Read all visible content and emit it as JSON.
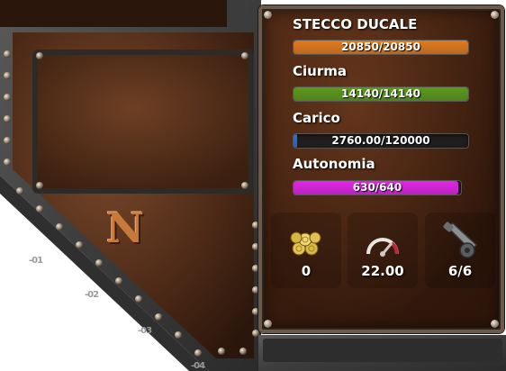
{
  "ship": {
    "name": "STECCO DUCALE"
  },
  "stats": [
    {
      "key": "hull",
      "label": "",
      "value_text": "20850/20850",
      "fill": 1.0,
      "color": "#e07b1f"
    },
    {
      "key": "crew",
      "label": "Ciurma",
      "value_text": "14140/14140",
      "fill": 1.0,
      "color": "#5c9a1e"
    },
    {
      "key": "cargo",
      "label": "Carico",
      "value_text": "2760.00/120000",
      "fill": 0.023,
      "color": "#2f6fd6"
    },
    {
      "key": "autonomy",
      "label": "Autonomia",
      "value_text": "630/640",
      "fill": 0.984,
      "color": "#e026e6"
    }
  ],
  "info": {
    "gold": {
      "icon": "gold-coins-icon",
      "value": "0"
    },
    "speed": {
      "icon": "speedometer-icon",
      "value": "22.00"
    },
    "cannons": {
      "icon": "cannon-icon",
      "value": "6/6"
    }
  },
  "compass_letter": "N",
  "coord_markers": [
    "-01",
    "-02",
    "-03",
    "-04"
  ],
  "colors": {
    "wood_dark": "#3a1d0e",
    "steel": "#4a4a4a",
    "brass": "#c8793a"
  }
}
